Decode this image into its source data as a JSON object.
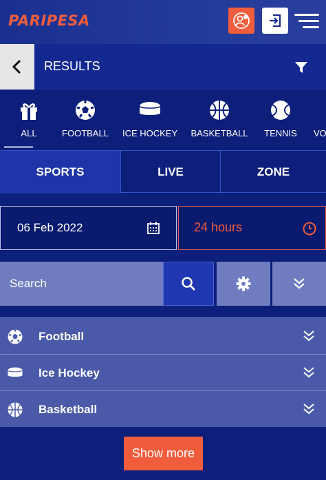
{
  "header": {
    "logo": "PARIPESA",
    "register_icon": "user-add-icon",
    "login_icon": "login-icon",
    "menu_icon": "menu-icon"
  },
  "results_bar": {
    "title": "RESULTS",
    "back_icon": "chevron-left-icon",
    "filter_icon": "filter-icon"
  },
  "sports": [
    {
      "label": "ALL",
      "icon": "gift-icon"
    },
    {
      "label": "FOOTBALL",
      "icon": "football-icon"
    },
    {
      "label": "ICE HOCKEY",
      "icon": "hockey-puck-icon"
    },
    {
      "label": "BASKETBALL",
      "icon": "basketball-icon"
    },
    {
      "label": "TENNIS",
      "icon": "tennis-ball-icon"
    },
    {
      "label": "VO"
    }
  ],
  "segments": [
    {
      "label": "SPORTS",
      "active": true
    },
    {
      "label": "LIVE",
      "active": false
    },
    {
      "label": "ZONE",
      "active": false
    }
  ],
  "date": {
    "value": "06 Feb 2022",
    "icon": "calendar-icon"
  },
  "period": {
    "value": "24 hours",
    "icon": "clock-icon"
  },
  "search": {
    "placeholder": "Search",
    "icon": "search-icon"
  },
  "list": [
    {
      "label": "Football",
      "icon": "football-icon"
    },
    {
      "label": "Ice Hockey",
      "icon": "hockey-puck-icon"
    },
    {
      "label": "Basketball",
      "icon": "basketball-icon"
    }
  ],
  "show_more": "Show more",
  "colors": {
    "accent": "#f05d3d",
    "background": "#0d1f7a",
    "row": "#4b5aa8"
  }
}
